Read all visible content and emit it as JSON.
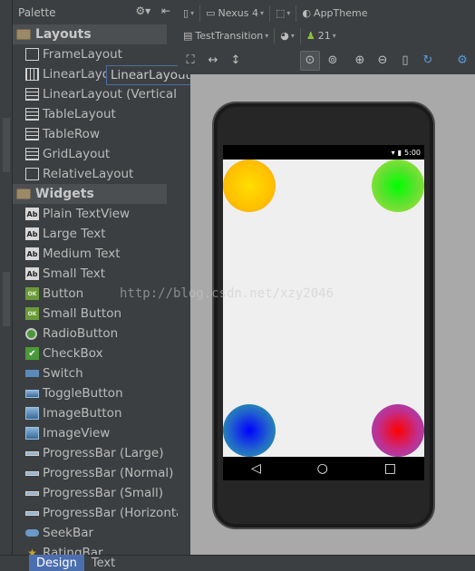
{
  "palette": {
    "title": "Palette",
    "tooltip": "LinearLayout (Horizontal)",
    "categories": [
      {
        "label": "Layouts",
        "items": [
          {
            "label": "FrameLayout",
            "icon": "frame-layout-icon"
          },
          {
            "label": "LinearLayout (Horizontal)",
            "icon": "linear-layout-horizontal-icon"
          },
          {
            "label": "LinearLayout (Vertical)",
            "icon": "linear-layout-vertical-icon"
          },
          {
            "label": "TableLayout",
            "icon": "table-layout-icon"
          },
          {
            "label": "TableRow",
            "icon": "table-row-icon"
          },
          {
            "label": "GridLayout",
            "icon": "grid-layout-icon"
          },
          {
            "label": "RelativeLayout",
            "icon": "relative-layout-icon"
          }
        ]
      },
      {
        "label": "Widgets",
        "items": [
          {
            "label": "Plain TextView",
            "icon": "textview-icon"
          },
          {
            "label": "Large Text",
            "icon": "textview-icon"
          },
          {
            "label": "Medium Text",
            "icon": "textview-icon"
          },
          {
            "label": "Small Text",
            "icon": "textview-icon"
          },
          {
            "label": "Button",
            "icon": "button-icon"
          },
          {
            "label": "Small Button",
            "icon": "button-icon"
          },
          {
            "label": "RadioButton",
            "icon": "radio-button-icon"
          },
          {
            "label": "CheckBox",
            "icon": "checkbox-icon"
          },
          {
            "label": "Switch",
            "icon": "switch-icon"
          },
          {
            "label": "ToggleButton",
            "icon": "toggle-button-icon"
          },
          {
            "label": "ImageButton",
            "icon": "image-button-icon"
          },
          {
            "label": "ImageView",
            "icon": "image-view-icon"
          },
          {
            "label": "ProgressBar (Large)",
            "icon": "progress-bar-icon"
          },
          {
            "label": "ProgressBar (Normal)",
            "icon": "progress-bar-icon"
          },
          {
            "label": "ProgressBar (Small)",
            "icon": "progress-bar-icon"
          },
          {
            "label": "ProgressBar (Horizontal)",
            "icon": "progress-bar-icon"
          },
          {
            "label": "SeekBar",
            "icon": "seekbar-icon"
          },
          {
            "label": "RatingBar",
            "icon": "rating-bar-icon"
          }
        ]
      }
    ]
  },
  "toolbar": {
    "device": "Nexus 4",
    "theme": "AppTheme",
    "activity": "TestTransition",
    "api": "21"
  },
  "phone": {
    "status_time": "5:00"
  },
  "watermark": "http://blog.csdn.net/xzy2046",
  "tabs": {
    "design": "Design",
    "text": "Text"
  }
}
